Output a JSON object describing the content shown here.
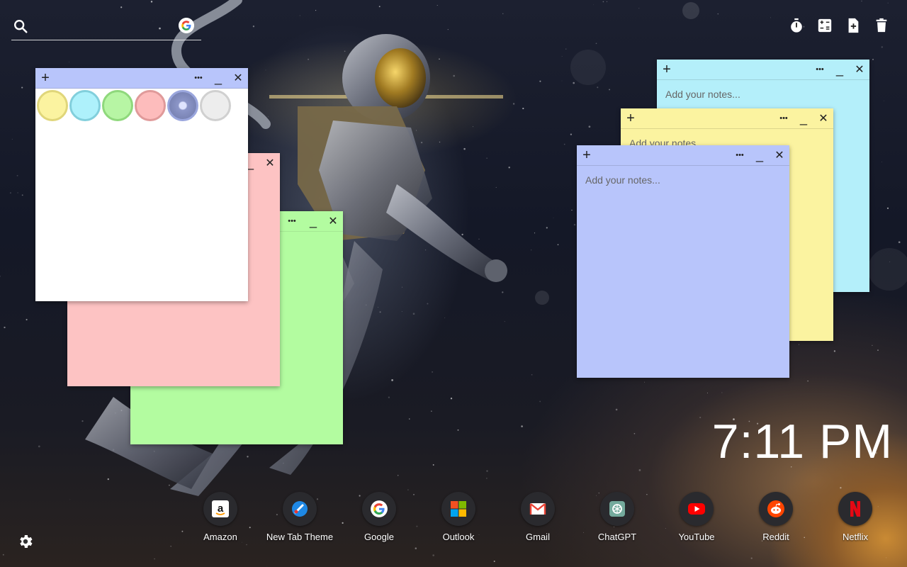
{
  "search": {
    "placeholder": ""
  },
  "top_tools": [
    {
      "name": "timer-icon"
    },
    {
      "name": "calculator-icon"
    },
    {
      "name": "add-note-icon"
    },
    {
      "name": "trash-icon"
    }
  ],
  "notes": {
    "placeholder": "Add your notes...",
    "add_glyph": "+",
    "menu_glyph": "•••",
    "minimize_glyph": "_",
    "close_glyph": "✕"
  },
  "palette": [
    {
      "name": "yellow",
      "fill": "#fbf3a0",
      "ring": "#e0d67a"
    },
    {
      "name": "cyan",
      "fill": "#aef1fb",
      "ring": "#82cfdc"
    },
    {
      "name": "green",
      "fill": "#b7f5a4",
      "ring": "#8fd87c"
    },
    {
      "name": "pink",
      "fill": "#fdbcbc",
      "ring": "#e09a9a"
    },
    {
      "name": "periwinkle",
      "fill": "#bcc6f8",
      "ring": "#9aa6dd"
    },
    {
      "name": "light-gray",
      "fill": "#ededed",
      "ring": "#d0d0d0"
    }
  ],
  "colors": {
    "yellow": "#fbf3a0",
    "cyan": "#b4effa",
    "green": "#b3fca0",
    "pink": "#fdc3c3",
    "periwinkle": "#b8c5fb",
    "white": "#ffffff"
  },
  "clock": {
    "time": "7:11 PM"
  },
  "shortcuts": [
    {
      "label": "Amazon",
      "icon": "amazon-icon"
    },
    {
      "label": "New Tab Theme",
      "icon": "new-tab-theme-icon"
    },
    {
      "label": "Google",
      "icon": "google-icon"
    },
    {
      "label": "Outlook",
      "icon": "outlook-icon"
    },
    {
      "label": "Gmail",
      "icon": "gmail-icon"
    },
    {
      "label": "ChatGPT",
      "icon": "chatgpt-icon"
    },
    {
      "label": "YouTube",
      "icon": "youtube-icon"
    },
    {
      "label": "Reddit",
      "icon": "reddit-icon"
    },
    {
      "label": "Netflix",
      "icon": "netflix-icon"
    }
  ]
}
